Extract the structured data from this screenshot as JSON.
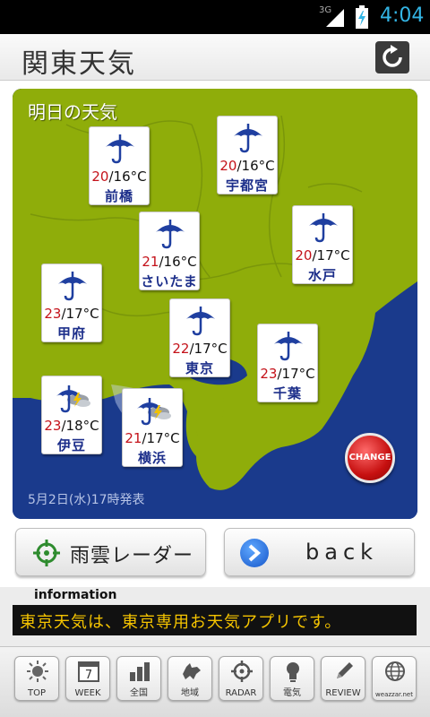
{
  "status_bar": {
    "network": "3G",
    "time": "4:04"
  },
  "header": {
    "title": "関東天気",
    "refresh_icon": "refresh-icon"
  },
  "panel": {
    "title": "明日の天気",
    "timestamp": "5月2日(水)17時発表",
    "change_label": "CHANGE",
    "colors": {
      "land": "#8fad0a",
      "sea": "#1a3a8c",
      "high": "#c4121a",
      "low": "#1f3fa0",
      "city": "#1c2e8a"
    },
    "cities": [
      {
        "name": "前橋",
        "high": "20",
        "low": "16",
        "unit": "°C",
        "icon": "umbrella-icon"
      },
      {
        "name": "宇都宮",
        "high": "20",
        "low": "16",
        "unit": "°C",
        "icon": "umbrella-icon"
      },
      {
        "name": "さいたま",
        "high": "21",
        "low": "16",
        "unit": "°C",
        "icon": "umbrella-icon"
      },
      {
        "name": "水戸",
        "high": "20",
        "low": "17",
        "unit": "°C",
        "icon": "umbrella-icon"
      },
      {
        "name": "甲府",
        "high": "23",
        "low": "17",
        "unit": "°C",
        "icon": "umbrella-icon"
      },
      {
        "name": "東京",
        "high": "22",
        "low": "17",
        "unit": "°C",
        "icon": "umbrella-icon"
      },
      {
        "name": "千葉",
        "high": "23",
        "low": "17",
        "unit": "°C",
        "icon": "umbrella-icon"
      },
      {
        "name": "伊豆",
        "high": "23",
        "low": "18",
        "unit": "°C",
        "icon": "umbrella-thunder-icon"
      },
      {
        "name": "横浜",
        "high": "21",
        "low": "17",
        "unit": "°C",
        "icon": "umbrella-thunder-icon"
      }
    ]
  },
  "buttons": {
    "radar": "雨雲レーダー",
    "back": "back"
  },
  "info": {
    "label": "information",
    "message": "東京天気は、東京専用お天気アプリです。"
  },
  "nav": [
    {
      "label": "TOP",
      "icon": "sun-icon"
    },
    {
      "label": "WEEK",
      "icon": "calendar-7-icon",
      "badge": "7"
    },
    {
      "label": "全国",
      "icon": "bar-graph-icon"
    },
    {
      "label": "地域",
      "icon": "hokkaido-map-icon"
    },
    {
      "label": "RADAR",
      "icon": "crosshair-icon"
    },
    {
      "label": "電気",
      "icon": "lightbulb-icon"
    },
    {
      "label": "REVIEW",
      "icon": "pencil-icon"
    },
    {
      "label": "weazzar.net",
      "icon": "globe-icon"
    }
  ]
}
